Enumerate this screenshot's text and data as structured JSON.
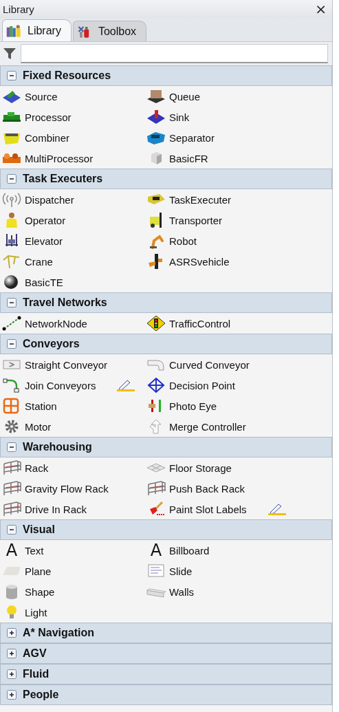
{
  "window": {
    "title": "Library",
    "close": "×"
  },
  "tabs": [
    {
      "label": "Library",
      "kind": "library",
      "selected": true
    },
    {
      "label": "Toolbox",
      "kind": "toolbox",
      "selected": false
    }
  ],
  "categories": [
    {
      "title": "Fixed Resources",
      "expanded": true,
      "items": [
        {
          "label": "Source",
          "kind": "source",
          "pencil": false
        },
        {
          "label": "Queue",
          "kind": "queue",
          "pencil": false
        },
        {
          "label": "Processor",
          "kind": "processor",
          "pencil": false
        },
        {
          "label": "Sink",
          "kind": "sink",
          "pencil": false
        },
        {
          "label": "Combiner",
          "kind": "combiner",
          "pencil": false
        },
        {
          "label": "Separator",
          "kind": "separator",
          "pencil": false
        },
        {
          "label": "MultiProcessor",
          "kind": "multiprocessor",
          "pencil": false
        },
        {
          "label": "BasicFR",
          "kind": "cube",
          "pencil": false
        }
      ]
    },
    {
      "title": "Task Executers",
      "expanded": true,
      "items": [
        {
          "label": "Dispatcher",
          "kind": "signal",
          "pencil": false
        },
        {
          "label": "TaskExecuter",
          "kind": "vehicle",
          "pencil": false
        },
        {
          "label": "Operator",
          "kind": "person",
          "pencil": false
        },
        {
          "label": "Transporter",
          "kind": "forklift",
          "pencil": false
        },
        {
          "label": "Elevator",
          "kind": "elevator",
          "pencil": false
        },
        {
          "label": "Robot",
          "kind": "robot",
          "pencil": false
        },
        {
          "label": "Crane",
          "kind": "crane",
          "pencil": false
        },
        {
          "label": "ASRSvehicle",
          "kind": "asrs",
          "pencil": false
        },
        {
          "label": "BasicTE",
          "kind": "sphere",
          "pencil": false
        }
      ]
    },
    {
      "title": "Travel Networks",
      "expanded": true,
      "items": [
        {
          "label": "NetworkNode",
          "kind": "node",
          "pencil": false
        },
        {
          "label": "TrafficControl",
          "kind": "traffic",
          "pencil": false
        }
      ]
    },
    {
      "title": "Conveyors",
      "expanded": true,
      "items": [
        {
          "label": "Straight Conveyor",
          "kind": "conveyor",
          "pencil": false
        },
        {
          "label": "Curved Conveyor",
          "kind": "curved",
          "pencil": false
        },
        {
          "label": "Join Conveyors",
          "kind": "join",
          "pencil": true
        },
        {
          "label": "Decision Point",
          "kind": "decision",
          "pencil": false
        },
        {
          "label": "Station",
          "kind": "station",
          "pencil": false
        },
        {
          "label": "Photo Eye",
          "kind": "photoeye",
          "pencil": false
        },
        {
          "label": "Motor",
          "kind": "gear",
          "pencil": false
        },
        {
          "label": "Merge Controller",
          "kind": "merge",
          "pencil": false
        }
      ]
    },
    {
      "title": "Warehousing",
      "expanded": true,
      "items": [
        {
          "label": "Rack",
          "kind": "rack",
          "pencil": false
        },
        {
          "label": "Floor Storage",
          "kind": "floor",
          "pencil": false
        },
        {
          "label": "Gravity Flow Rack",
          "kind": "rack",
          "pencil": false
        },
        {
          "label": "Push Back Rack",
          "kind": "rack",
          "pencil": false
        },
        {
          "label": "Drive In Rack",
          "kind": "rack",
          "pencil": false
        },
        {
          "label": "Paint Slot Labels",
          "kind": "brush",
          "pencil": true
        }
      ]
    },
    {
      "title": "Visual",
      "expanded": true,
      "items": [
        {
          "label": "Text",
          "kind": "glyph",
          "glyph": "A",
          "pencil": false
        },
        {
          "label": "Billboard",
          "kind": "glyph",
          "glyph": "A",
          "pencil": false
        },
        {
          "label": "Plane",
          "kind": "plane",
          "pencil": false
        },
        {
          "label": "Slide",
          "kind": "slide",
          "pencil": false
        },
        {
          "label": "Shape",
          "kind": "cylinder",
          "pencil": false
        },
        {
          "label": "Walls",
          "kind": "wall",
          "pencil": false
        },
        {
          "label": "Light",
          "kind": "bulb",
          "pencil": false
        }
      ]
    },
    {
      "title": "A* Navigation",
      "expanded": false
    },
    {
      "title": "AGV",
      "expanded": false
    },
    {
      "title": "Fluid",
      "expanded": false
    },
    {
      "title": "People",
      "expanded": false
    }
  ]
}
